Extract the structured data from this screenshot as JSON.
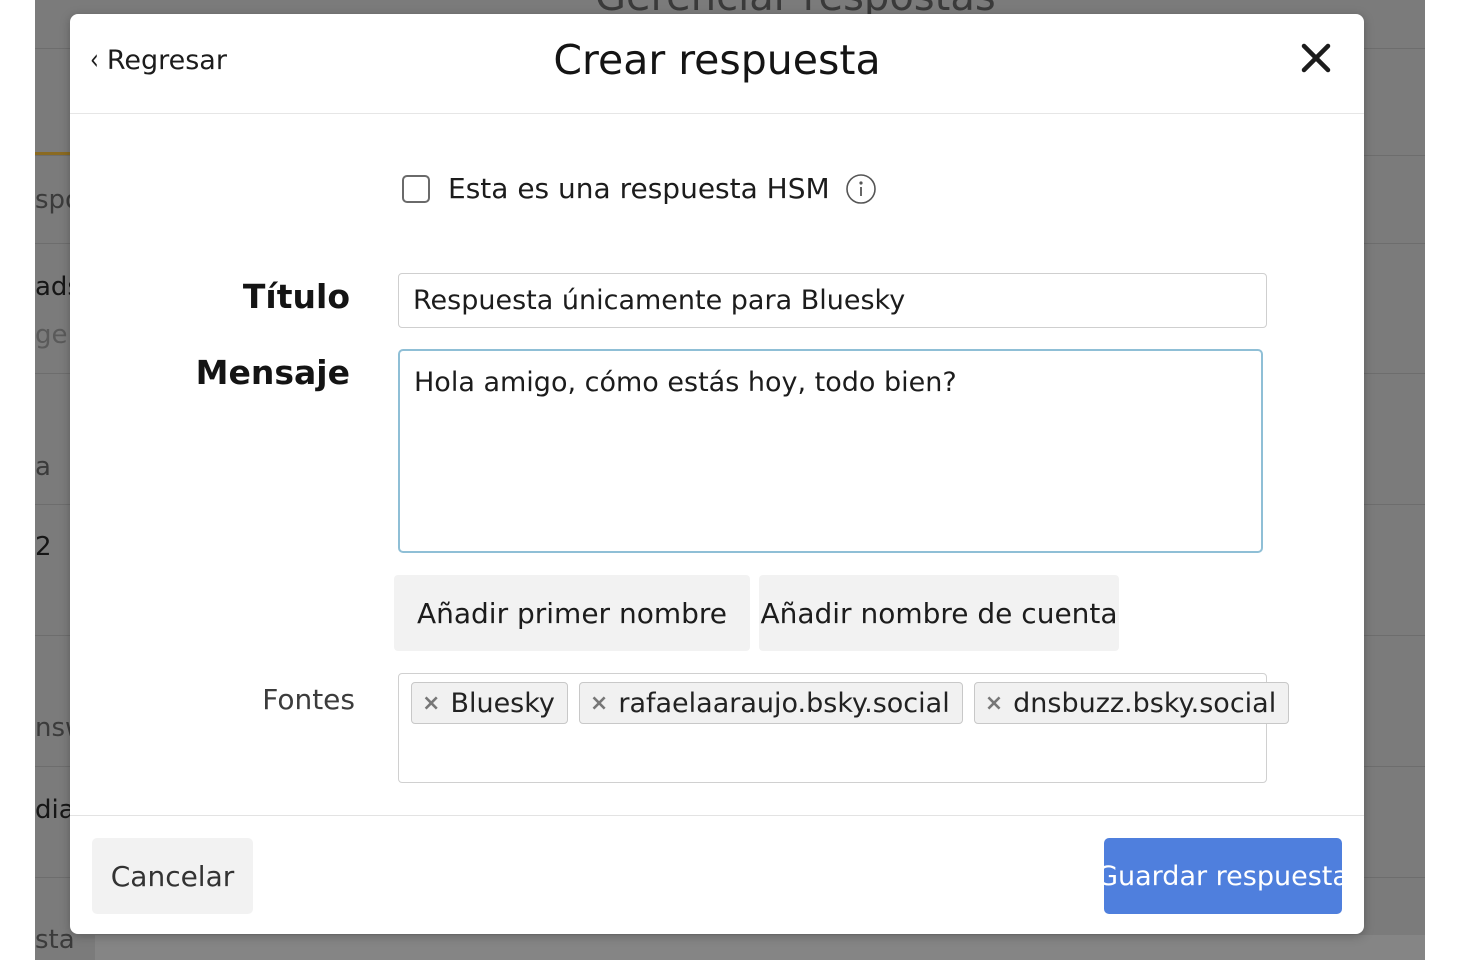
{
  "background": {
    "page_title": "Gerenciar respostas",
    "fragments": [
      "spo",
      "ads",
      "ge",
      "a",
      "2",
      "nsw",
      "dia",
      "sta"
    ]
  },
  "modal": {
    "back_label": "Regresar",
    "title": "Crear respuesta",
    "close_icon": "close-icon",
    "hsm": {
      "label": "Esta es una respuesta HSM",
      "checked": false,
      "info_icon": "info-icon"
    },
    "titulo": {
      "label": "Título",
      "value": "Respuesta únicamente para Bluesky"
    },
    "mensaje": {
      "label": "Mensaje",
      "value": "Hola amigo, cómo estás hoy, todo bien?"
    },
    "variable_buttons": [
      "Añadir primer nombre",
      "Añadir nombre de cuenta"
    ],
    "fontes": {
      "label": "Fontes",
      "tags": [
        "Bluesky",
        "rafaelaaraujo.bsky.social",
        "dnsbuzz.bsky.social"
      ]
    },
    "footer": {
      "cancel_label": "Cancelar",
      "save_label": "Guardar respuesta"
    }
  },
  "colors": {
    "primary_button": "#4f7fdd",
    "textarea_focus_border": "#8fbfd6",
    "overlay": "#7b7b7b"
  }
}
